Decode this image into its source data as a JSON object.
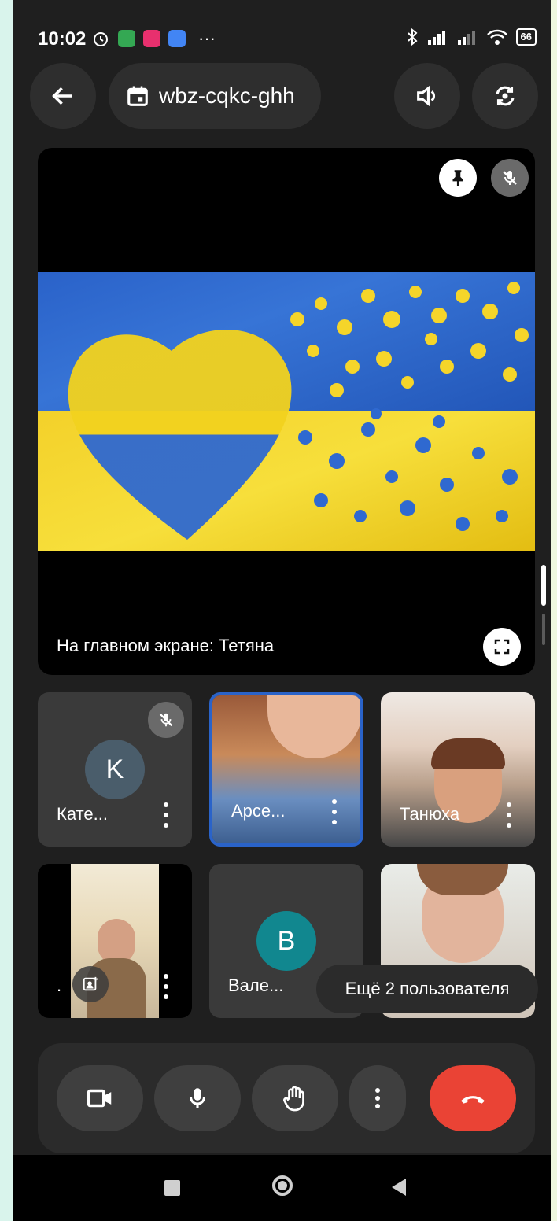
{
  "status_bar": {
    "time": "10:02",
    "more": "···",
    "battery": "66",
    "app_icon_colors": [
      "#34a853",
      "#e8306e",
      "#4285f4"
    ]
  },
  "header": {
    "meeting_code": "wbz-cqkc-ghh",
    "icons": [
      "back-arrow-icon",
      "calendar-icon",
      "speaker-icon",
      "switch-camera-icon"
    ]
  },
  "stage": {
    "label": "На главном экране: Тетяна",
    "icons": [
      "pin-icon",
      "mic-off-icon",
      "fullscreen-icon"
    ]
  },
  "tiles": [
    {
      "name": "Кате...",
      "type": "avatar",
      "initial": "K",
      "avatar_color": "#4a5d6b",
      "muted": true
    },
    {
      "name": "Арсе...",
      "type": "video",
      "speaking": true
    },
    {
      "name": "Танюха",
      "type": "video"
    },
    {
      "name": ".",
      "type": "video"
    },
    {
      "name": "Вале...",
      "type": "avatar",
      "initial": "B",
      "avatar_color": "#11878f"
    },
    {
      "name": "",
      "type": "video"
    }
  ],
  "more_users": "Ещё 2 пользователя",
  "controls": {
    "icons": [
      "camera-icon",
      "mic-icon",
      "raise-hand-icon",
      "more-vert-icon",
      "end-call-icon"
    ],
    "end_color": "#ea4335"
  }
}
